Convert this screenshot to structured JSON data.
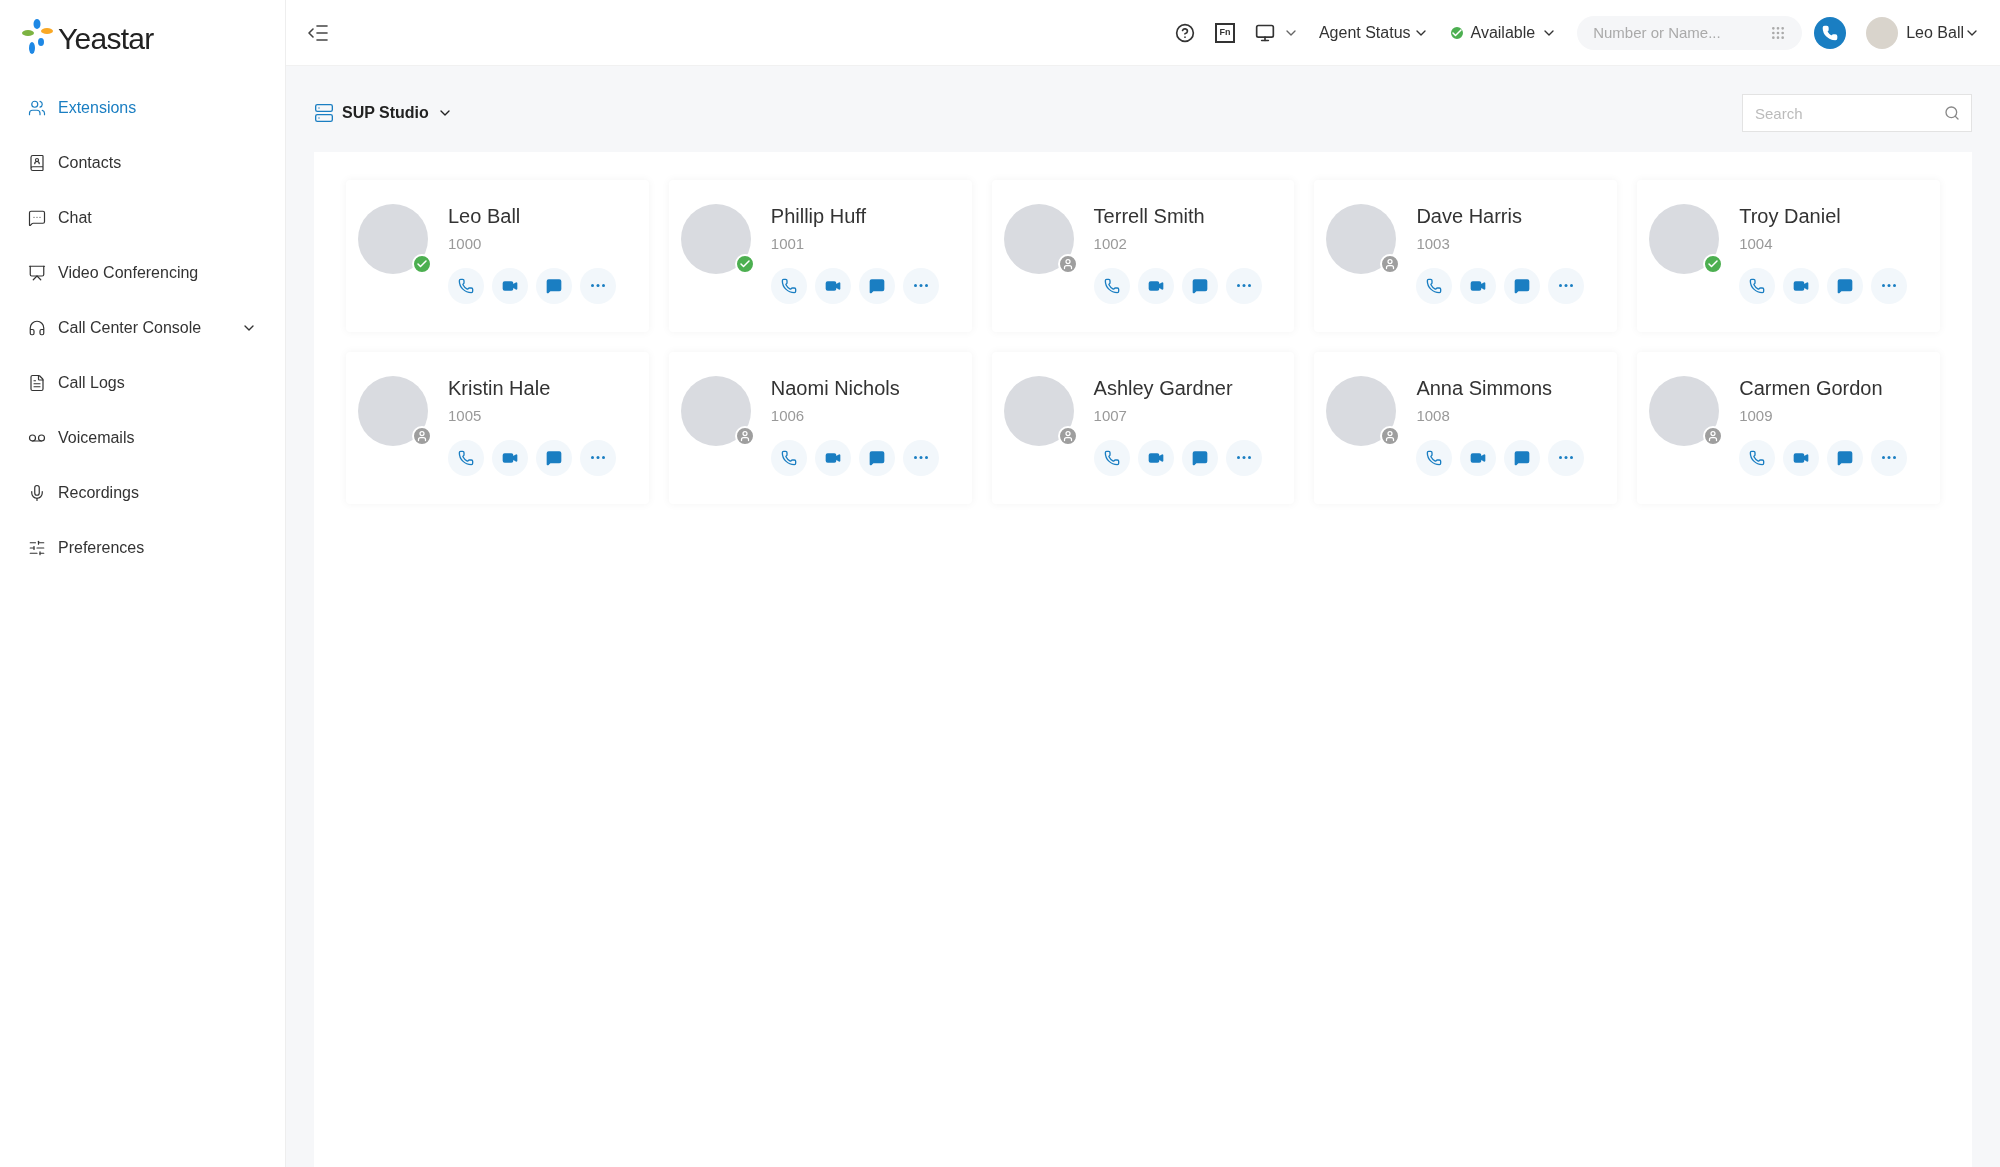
{
  "logo": {
    "text": "Yeastar"
  },
  "sidebar": {
    "items": [
      {
        "label": "Extensions",
        "selected": true,
        "expandable": false
      },
      {
        "label": "Contacts",
        "selected": false,
        "expandable": false
      },
      {
        "label": "Chat",
        "selected": false,
        "expandable": false
      },
      {
        "label": "Video Conferencing",
        "selected": false,
        "expandable": false
      },
      {
        "label": "Call Center Console",
        "selected": false,
        "expandable": true
      },
      {
        "label": "Call Logs",
        "selected": false,
        "expandable": false
      },
      {
        "label": "Voicemails",
        "selected": false,
        "expandable": false
      },
      {
        "label": "Recordings",
        "selected": false,
        "expandable": false
      },
      {
        "label": "Preferences",
        "selected": false,
        "expandable": false
      }
    ]
  },
  "topbar": {
    "fn_key": "Fn",
    "agent_status": "Agent Status",
    "presence": {
      "label": "Available",
      "online": true
    },
    "dial": {
      "placeholder": "Number or Name..."
    },
    "user": "Leo Ball"
  },
  "group": {
    "label": "SUP Studio"
  },
  "search": {
    "placeholder": "Search"
  },
  "extensions": [
    {
      "name": "Leo Ball",
      "number": "1000",
      "online": true
    },
    {
      "name": "Phillip Huff",
      "number": "1001",
      "online": true
    },
    {
      "name": "Terrell Smith",
      "number": "1002",
      "online": false
    },
    {
      "name": "Dave Harris",
      "number": "1003",
      "online": false
    },
    {
      "name": "Troy Daniel",
      "number": "1004",
      "online": true
    },
    {
      "name": "Kristin Hale",
      "number": "1005",
      "online": false
    },
    {
      "name": "Naomi Nichols",
      "number": "1006",
      "online": false
    },
    {
      "name": "Ashley Gardner",
      "number": "1007",
      "online": false
    },
    {
      "name": "Anna Simmons",
      "number": "1008",
      "online": false
    },
    {
      "name": "Carmen Gordon",
      "number": "1009",
      "online": false
    }
  ]
}
